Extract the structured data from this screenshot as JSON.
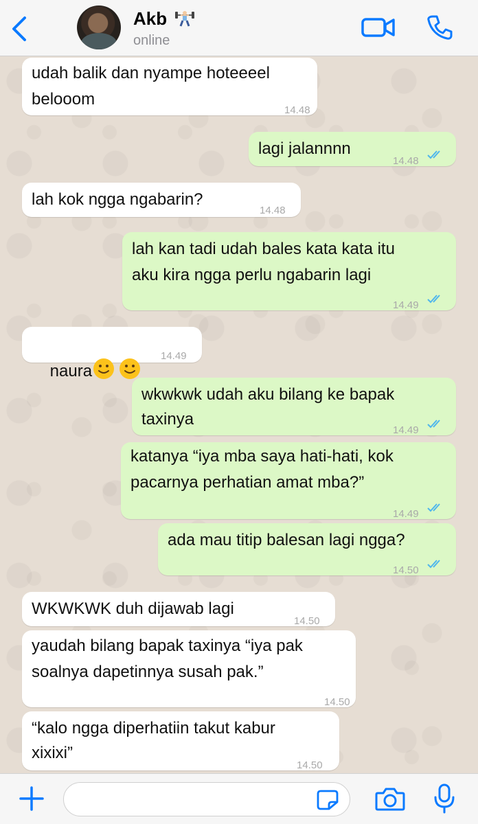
{
  "header": {
    "back_icon": "chevron-left-icon",
    "contact_name": "Akb",
    "name_emoji": "weightlifter-emoji",
    "status": "online",
    "video_icon": "video-camera-icon",
    "call_icon": "phone-icon",
    "accent": "#0a7aff"
  },
  "messages": [
    {
      "dir": "in",
      "lines": [
        "udah balik dan nyampe hoteeeel",
        "belooom"
      ],
      "time": "14.48"
    },
    {
      "dir": "out",
      "lines": [
        "lagi jalannnn"
      ],
      "time": "14.48",
      "status": "read"
    },
    {
      "dir": "in",
      "lines": [
        "lah kok ngga ngabarin?"
      ],
      "time": "14.48"
    },
    {
      "dir": "out",
      "lines": [
        "lah kan tadi udah bales kata kata itu",
        "aku kira ngga perlu ngabarin lagi"
      ],
      "time": "14.49",
      "status": "read"
    },
    {
      "dir": "in",
      "lines": [
        "naura"
      ],
      "emoji": "slightly-smiling-face-emoji x2",
      "time": "14.49"
    },
    {
      "dir": "out",
      "lines": [
        "wkwkwk udah aku bilang ke bapak",
        "taxinya"
      ],
      "time": "14.49",
      "status": "read"
    },
    {
      "dir": "out",
      "lines": [
        "katanya “iya mba saya hati-hati, kok",
        "pacarnya perhatian amat mba?”"
      ],
      "time": "14.49",
      "status": "read"
    },
    {
      "dir": "out",
      "lines": [
        "ada mau titip balesan lagi ngga?"
      ],
      "time": "14.50",
      "status": "read"
    },
    {
      "dir": "in",
      "lines": [
        "WKWKWK duh dijawab lagi"
      ],
      "time": "14.50"
    },
    {
      "dir": "in",
      "lines": [
        "yaudah bilang bapak taxinya “iya pak",
        "soalnya dapetinnya susah pak.”"
      ],
      "time": "14.50"
    },
    {
      "dir": "in",
      "lines": [
        "“kalo ngga diperhatiin takut kabur",
        "xixixi”"
      ],
      "time": "14.50"
    }
  ],
  "footer": {
    "add_icon": "plus-icon",
    "message_placeholder": "",
    "sticker_icon": "sticker-icon",
    "camera_icon": "camera-icon",
    "mic_icon": "microphone-icon"
  },
  "colors": {
    "incoming_bubble": "#ffffff",
    "outgoing_bubble": "#dcf8c6",
    "read_ticks": "#4fb6ec",
    "wallpaper": "#e6ddd3"
  }
}
